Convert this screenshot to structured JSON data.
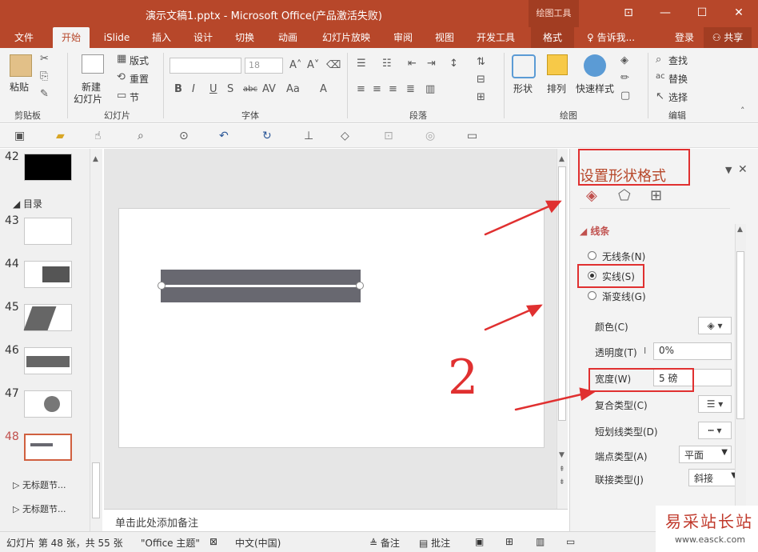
{
  "window": {
    "title": "演示文稿1.pptx - Microsoft Office(产品激活失败)",
    "context_tab": "绘图工具"
  },
  "tabs": [
    "文件",
    "开始",
    "iSlide",
    "插入",
    "设计",
    "切换",
    "动画",
    "幻灯片放映",
    "审阅",
    "视图",
    "开发工具",
    "格式"
  ],
  "tell_me": "告诉我...",
  "login": "登录",
  "share": "共享",
  "ribbon": {
    "clipboard": {
      "paste": "粘贴",
      "label": "剪贴板"
    },
    "slides": {
      "new_slide": "新建",
      "new_slide2": "幻灯片",
      "layout": "版式",
      "reset": "重置",
      "section": "节",
      "label": "幻灯片"
    },
    "font": {
      "size": "18",
      "label": "字体"
    },
    "paragraph": {
      "label": "段落"
    },
    "drawing": {
      "shape": "形状",
      "arrange": "排列",
      "quick_styles": "快速样式",
      "label": "绘图"
    },
    "editing": {
      "find": "查找",
      "replace": "替换",
      "select": "选择",
      "label": "编辑"
    }
  },
  "thumbnails": {
    "slides": [
      "42",
      "43",
      "44",
      "45",
      "46",
      "47",
      "48"
    ],
    "sections": {
      "toc": "目录",
      "untitled1": "无标题节...",
      "untitled2": "无标题节..."
    }
  },
  "notes": "单击此处添加备注",
  "format_pane": {
    "title": "设置形状格式",
    "section": "线条",
    "no_line": "无线条(N)",
    "solid_line": "实线(S)",
    "gradient_line": "渐变线(G)",
    "color": "颜色(C)",
    "transparency": "透明度(T)",
    "transparency_value": "0%",
    "width": "宽度(W)",
    "width_value": "5 磅",
    "compound_type": "复合类型(C)",
    "dash_type": "短划线类型(D)",
    "cap_type": "端点类型(A)",
    "cap_value": "平面",
    "join_type": "联接类型(J)",
    "join_value": "斜接"
  },
  "annotation_text": "2",
  "status": {
    "slide_info": "幻灯片 第 48 张，共 55 张",
    "theme": "\"Office 主题\"",
    "language": "中文(中国)",
    "notes": "备注",
    "comments": "批注"
  },
  "watermark": {
    "line1": "易采站长站",
    "line2": "www.easck.com"
  },
  "colors": {
    "accent": "#b7472a",
    "annotation": "#e03030",
    "line_fill": "#686870"
  }
}
